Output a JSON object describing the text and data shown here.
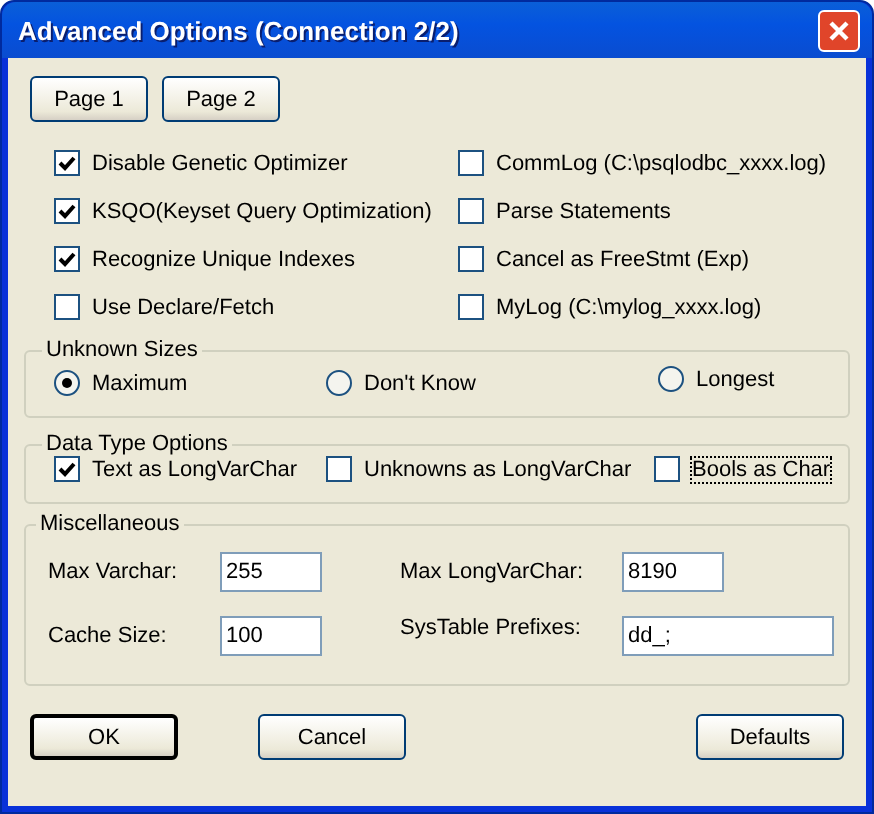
{
  "window": {
    "title": "Advanced Options (Connection 2/2)"
  },
  "pages": [
    {
      "label": "Page 1"
    },
    {
      "label": "Page 2"
    }
  ],
  "options": [
    {
      "label": "Disable Genetic Optimizer",
      "checked": true
    },
    {
      "label": "CommLog (C:\\psqlodbc_xxxx.log)",
      "checked": false
    },
    {
      "label": "KSQO(Keyset Query Optimization)",
      "checked": true
    },
    {
      "label": "Parse Statements",
      "checked": false
    },
    {
      "label": "Recognize Unique Indexes",
      "checked": true
    },
    {
      "label": "Cancel as FreeStmt (Exp)",
      "checked": false
    },
    {
      "label": "Use Declare/Fetch",
      "checked": false
    },
    {
      "label": "MyLog (C:\\mylog_xxxx.log)",
      "checked": false
    }
  ],
  "unknown_sizes": {
    "title": "Unknown Sizes",
    "choices": [
      {
        "label": "Maximum",
        "selected": true
      },
      {
        "label": "Don't Know",
        "selected": false
      },
      {
        "label": "Longest",
        "selected": false
      }
    ]
  },
  "data_type_options": {
    "title": "Data Type Options",
    "options": [
      {
        "label": "Text as LongVarChar",
        "checked": true,
        "focused": false
      },
      {
        "label": "Unknowns as LongVarChar",
        "checked": false,
        "focused": false
      },
      {
        "label": "Bools as Char",
        "checked": false,
        "focused": true
      }
    ]
  },
  "miscellaneous": {
    "title": "Miscellaneous",
    "fields": [
      {
        "label": "Max Varchar:",
        "value": "255"
      },
      {
        "label": "Max LongVarChar:",
        "value": "8190"
      },
      {
        "label": "Cache Size:",
        "value": "100"
      },
      {
        "label": "SysTable Prefixes:",
        "value": "dd_;"
      }
    ]
  },
  "buttons": [
    {
      "label": "OK",
      "default": true
    },
    {
      "label": "Cancel",
      "default": false
    },
    {
      "label": "Defaults",
      "default": false
    }
  ]
}
